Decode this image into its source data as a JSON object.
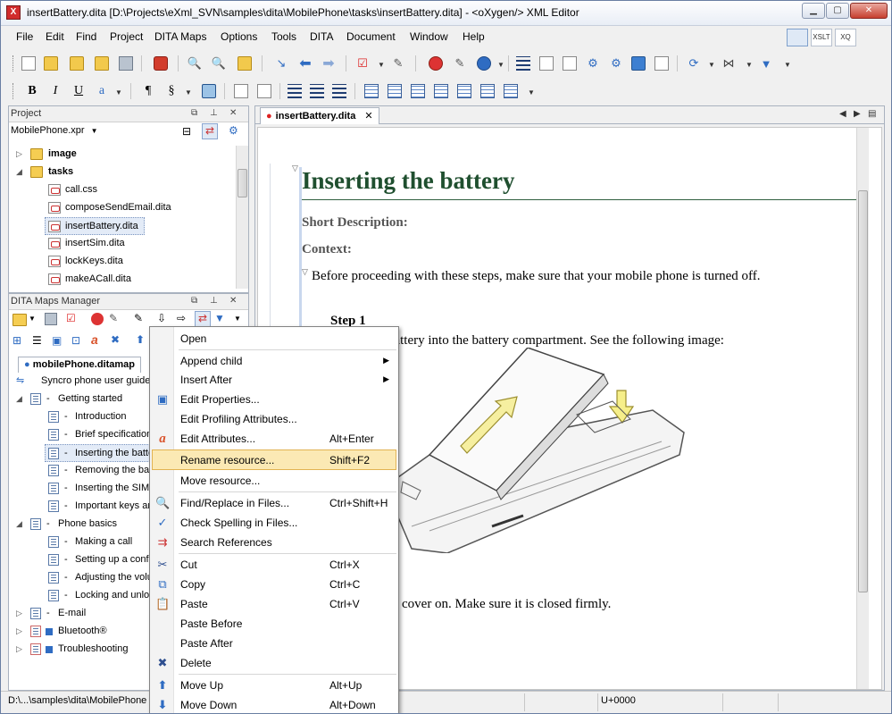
{
  "window": {
    "title": "insertBattery.dita [D:\\Projects\\eXml_SVN\\samples\\dita\\MobilePhone\\tasks\\insertBattery.dita] - <oXygen/> XML Editor",
    "app_icon": "X"
  },
  "menu": {
    "items": [
      "File",
      "Edit",
      "Find",
      "Project",
      "DITA Maps",
      "Options",
      "Tools",
      "DITA",
      "Document",
      "Window",
      "Help"
    ]
  },
  "perspectives": [
    "",
    "XSLT",
    "XQ"
  ],
  "project_panel": {
    "title": "Project",
    "project_file": "MobilePhone.xpr",
    "items": [
      {
        "label": "image",
        "type": "folder",
        "expanded": false,
        "bold": true
      },
      {
        "label": "tasks",
        "type": "folder",
        "expanded": true,
        "bold": true
      },
      {
        "label": "call.css",
        "type": "file"
      },
      {
        "label": "composeSendEmail.dita",
        "type": "file"
      },
      {
        "label": "insertBattery.dita",
        "type": "file",
        "selected": true
      },
      {
        "label": "insertSim.dita",
        "type": "file"
      },
      {
        "label": "lockKeys.dita",
        "type": "file"
      },
      {
        "label": "makeACall.dita",
        "type": "file"
      }
    ]
  },
  "maps_panel": {
    "title": "DITA Maps Manager",
    "tab": "mobilePhone.ditamap",
    "tree": [
      {
        "label": "Syncro phone user guide",
        "level": 0
      },
      {
        "label": "Getting started",
        "level": 1,
        "expanded": true
      },
      {
        "label": "Introduction",
        "level": 2
      },
      {
        "label": "Brief specification",
        "level": 2
      },
      {
        "label": "Inserting the battery",
        "level": 2,
        "selected": true
      },
      {
        "label": "Removing the battery",
        "level": 2
      },
      {
        "label": "Inserting the SIM",
        "level": 2
      },
      {
        "label": "Important keys and",
        "level": 2
      },
      {
        "label": "Phone basics",
        "level": 1,
        "expanded": true
      },
      {
        "label": "Making a call",
        "level": 2
      },
      {
        "label": "Setting up a conference",
        "level": 2
      },
      {
        "label": "Adjusting the volume",
        "level": 2
      },
      {
        "label": "Locking and unlocking",
        "level": 2
      },
      {
        "label": "E-mail",
        "level": 1
      },
      {
        "label": "Bluetooth®",
        "level": 1
      },
      {
        "label": "Troubleshooting",
        "level": 1
      }
    ]
  },
  "editor": {
    "tab_label": "insertBattery.dita",
    "tab_close": "✕",
    "document": {
      "title": "Inserting the battery",
      "short_description_label": "Short Description:",
      "context_label": "Context:",
      "context_text": "Before proceeding with these steps, make sure that your mobile phone is turned off.",
      "step_label": "Step 1",
      "step_text": "Insert the battery into the battery compartment. See the following image:",
      "cover_text": "cover on. Make sure it is closed firmly."
    }
  },
  "context_menu": {
    "items": [
      {
        "label": "Open",
        "shortcut": "",
        "icon": "",
        "submenu": false
      },
      {
        "sep": true
      },
      {
        "label": "Append child",
        "shortcut": "",
        "icon": "",
        "submenu": true
      },
      {
        "label": "Insert After",
        "shortcut": "",
        "icon": "",
        "submenu": true
      },
      {
        "label": "Edit Properties...",
        "shortcut": "",
        "icon": "properties-icon",
        "submenu": false
      },
      {
        "label": "Edit Profiling Attributes...",
        "shortcut": "",
        "icon": "",
        "submenu": false
      },
      {
        "label": "Edit Attributes...",
        "shortcut": "Alt+Enter",
        "icon": "attributes-icon",
        "submenu": false
      },
      {
        "label": "Rename resource...",
        "shortcut": "Shift+F2",
        "icon": "",
        "submenu": false,
        "highlighted": true
      },
      {
        "label": "Move resource...",
        "shortcut": "",
        "icon": "",
        "submenu": false
      },
      {
        "sep": true
      },
      {
        "label": "Find/Replace in Files...",
        "shortcut": "Ctrl+Shift+H",
        "icon": "find-replace-icon",
        "submenu": false
      },
      {
        "label": "Check Spelling in Files...",
        "shortcut": "",
        "icon": "spellcheck-icon",
        "submenu": false
      },
      {
        "label": "Search References",
        "shortcut": "",
        "icon": "search-references-icon",
        "submenu": false
      },
      {
        "sep": true
      },
      {
        "label": "Cut",
        "shortcut": "Ctrl+X",
        "icon": "cut-icon",
        "submenu": false
      },
      {
        "label": "Copy",
        "shortcut": "Ctrl+C",
        "icon": "copy-icon",
        "submenu": false
      },
      {
        "label": "Paste",
        "shortcut": "Ctrl+V",
        "icon": "paste-icon",
        "submenu": false
      },
      {
        "label": "Paste Before",
        "shortcut": "",
        "icon": "",
        "submenu": false
      },
      {
        "label": "Paste After",
        "shortcut": "",
        "icon": "",
        "submenu": false
      },
      {
        "label": "Delete",
        "shortcut": "",
        "icon": "delete-icon",
        "submenu": false
      },
      {
        "sep": true
      },
      {
        "label": "Move Up",
        "shortcut": "Alt+Up",
        "icon": "move-up-icon",
        "submenu": false
      },
      {
        "label": "Move Down",
        "shortcut": "Alt+Down",
        "icon": "move-down-icon",
        "submenu": false
      }
    ]
  },
  "statusbar": {
    "path": "D:\\...\\samples\\dita\\MobilePhone",
    "encoding": "U+0000"
  },
  "colors": {
    "title_green": "#1f4f2f",
    "highlight": "#fbe9b4",
    "accent_blue": "#2f6cc2"
  }
}
